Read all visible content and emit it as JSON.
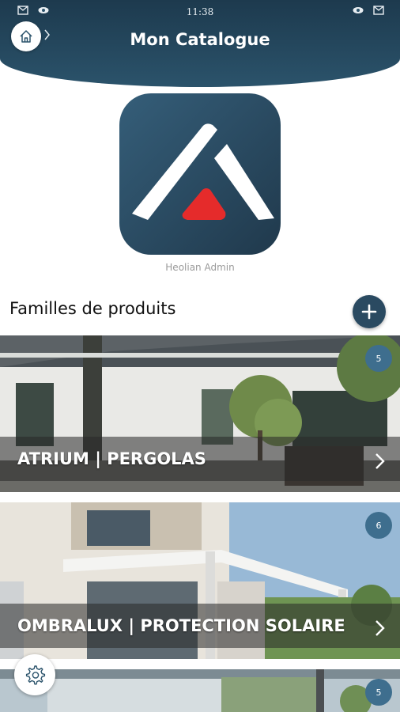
{
  "status_bar": {
    "time": "11:38",
    "left_icons": [
      "mail-icon",
      "eye-icon"
    ],
    "right_icons": [
      "eye-icon",
      "mail-icon"
    ]
  },
  "header": {
    "title": "Mon Catalogue",
    "background_color": "#1d3a4e"
  },
  "brand": {
    "caption": "Heolian Admin",
    "accent_color": "#e52b2b"
  },
  "section": {
    "title": "Familles de produits",
    "add_icon": "plus-icon"
  },
  "families": [
    {
      "label": "ATRIUM | PERGOLAS",
      "count": "5"
    },
    {
      "label": "OMBRALUX | PROTECTION SOLAIRE",
      "count": "6"
    },
    {
      "label": "",
      "count": "5"
    }
  ],
  "footer": {
    "settings_icon": "gear-icon"
  }
}
